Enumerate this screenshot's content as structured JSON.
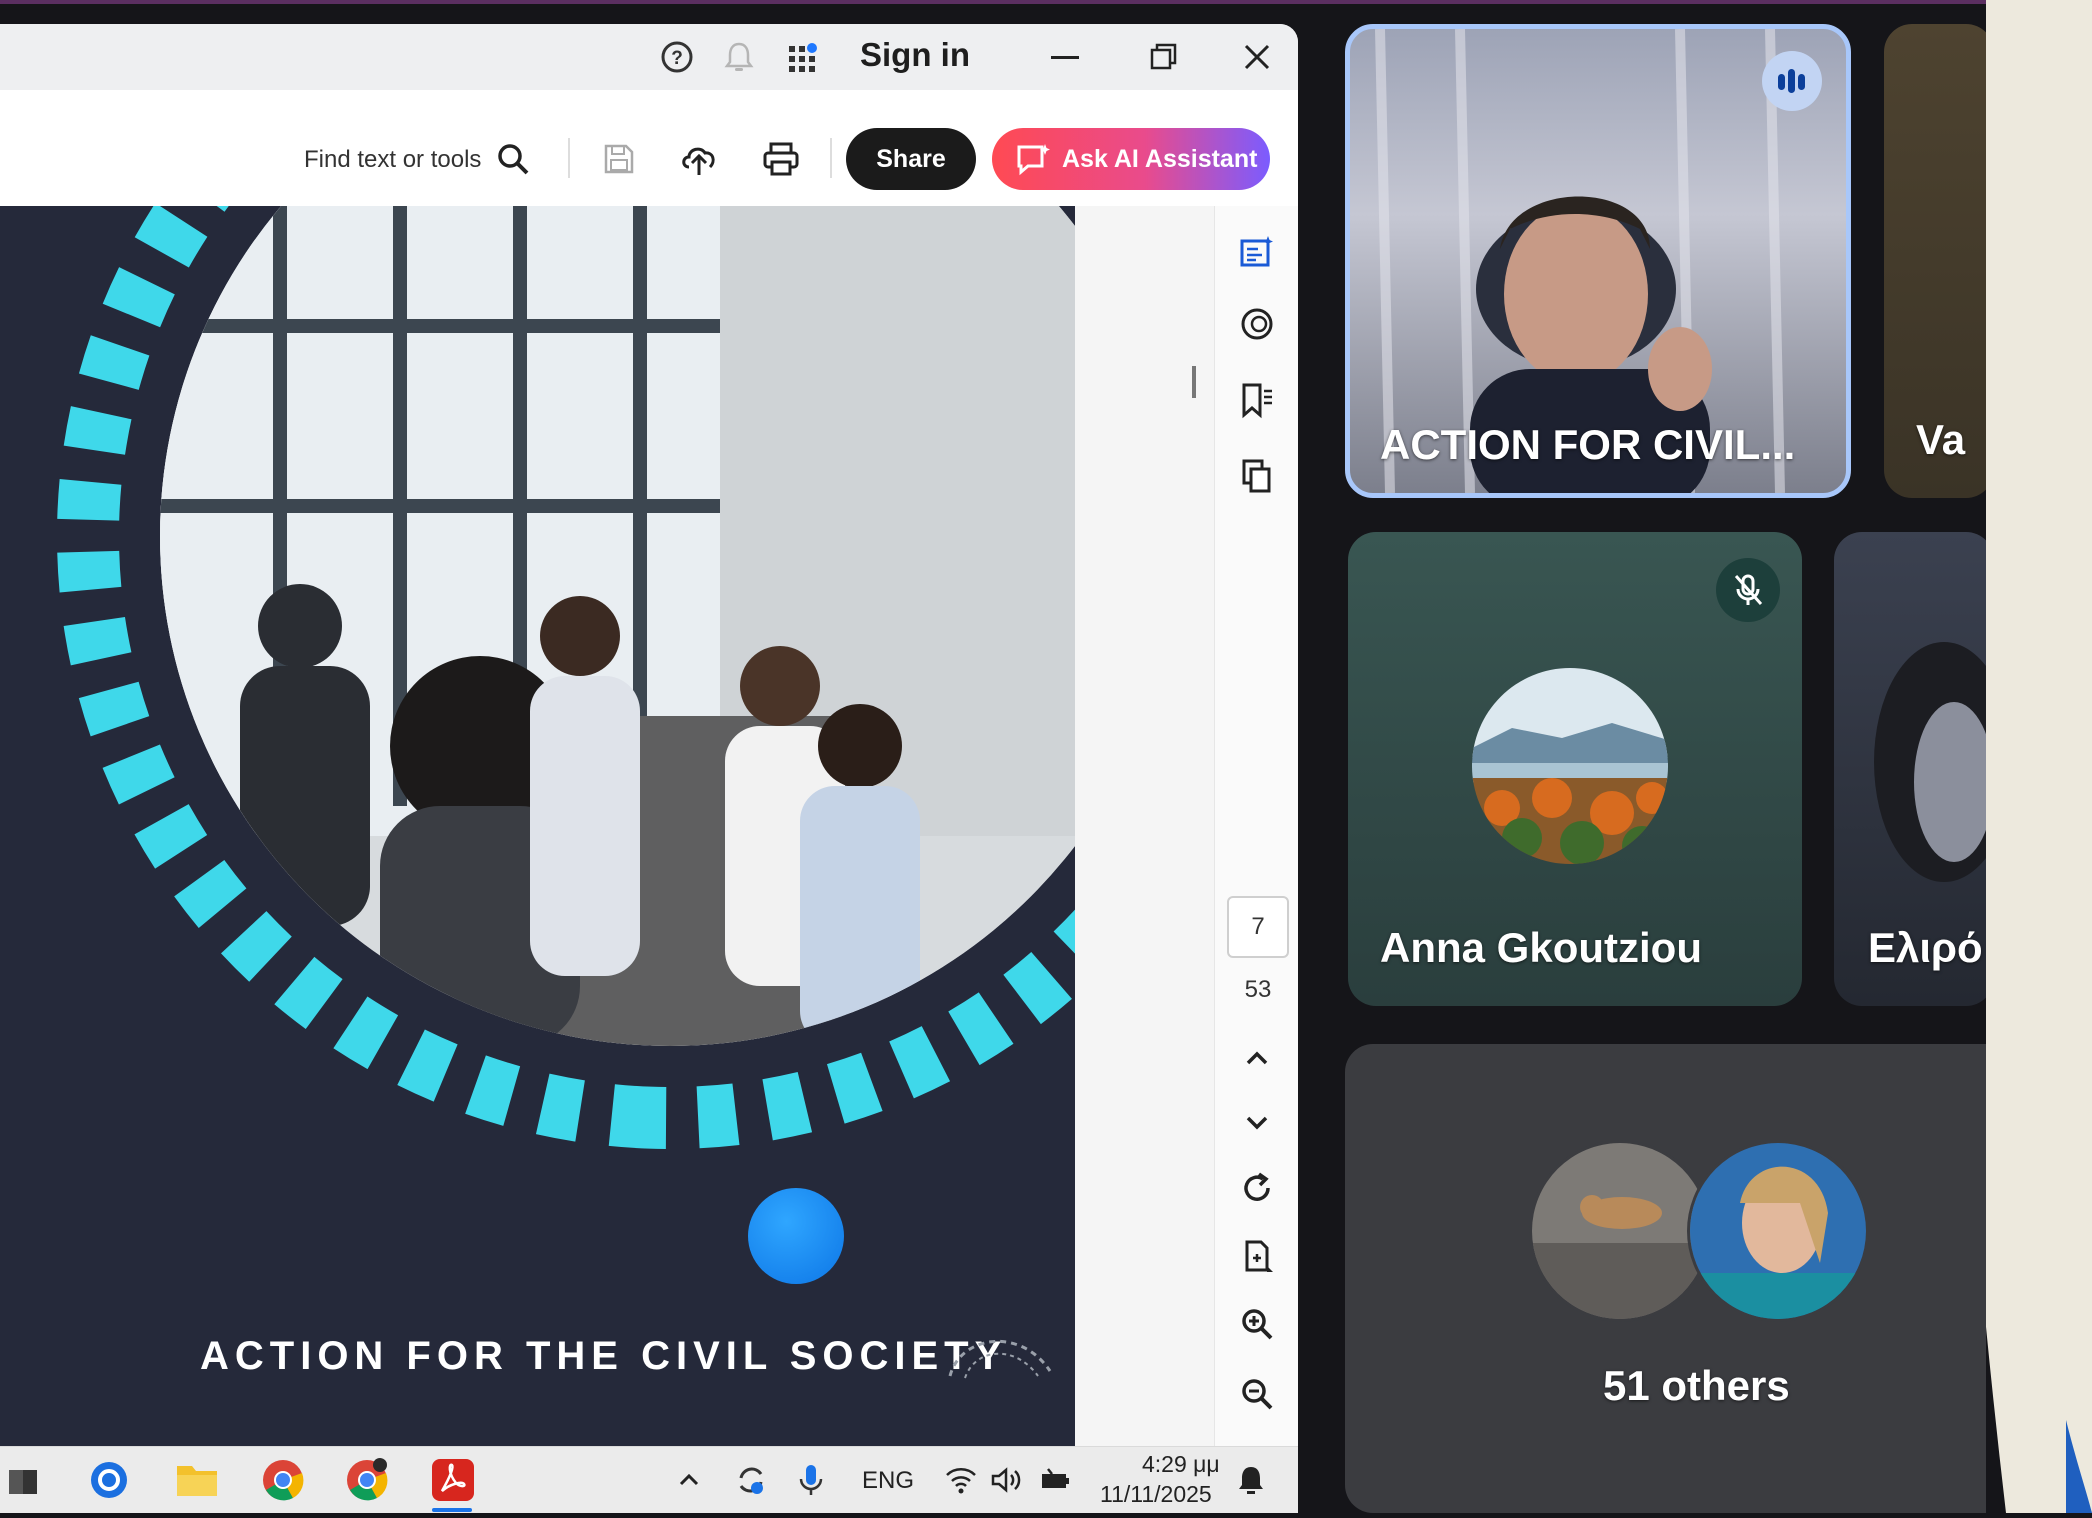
{
  "acrobat": {
    "title_bar": {
      "signin_label": "Sign in"
    },
    "toolbar": {
      "find_label": "Find text or tools",
      "share_label": "Share",
      "ask_ai_label": "Ask AI Assistant"
    },
    "slide": {
      "caption": "ACTION FOR THE CIVIL SOCIETY"
    },
    "page_nav": {
      "current_page": "7",
      "total_pages": "53"
    }
  },
  "taskbar": {
    "language": "ENG",
    "time": "4:29 μμ",
    "date": "11/11/2025"
  },
  "meet": {
    "speaker_tile": {
      "name": "ACTION FOR CIVIL..."
    },
    "partial_tile_1": {
      "name": "Va"
    },
    "anna_tile": {
      "name": "Anna Gkoutziou"
    },
    "partial_tile_2": {
      "name": "Ελιρό"
    },
    "others_tile": {
      "label": "51 others"
    }
  },
  "colors": {
    "slide_bg": "#25293a",
    "stripe_cyan": "#3fd8ea",
    "active_speaker_border": "#a8c7fa",
    "meet_bg": "#151519"
  }
}
